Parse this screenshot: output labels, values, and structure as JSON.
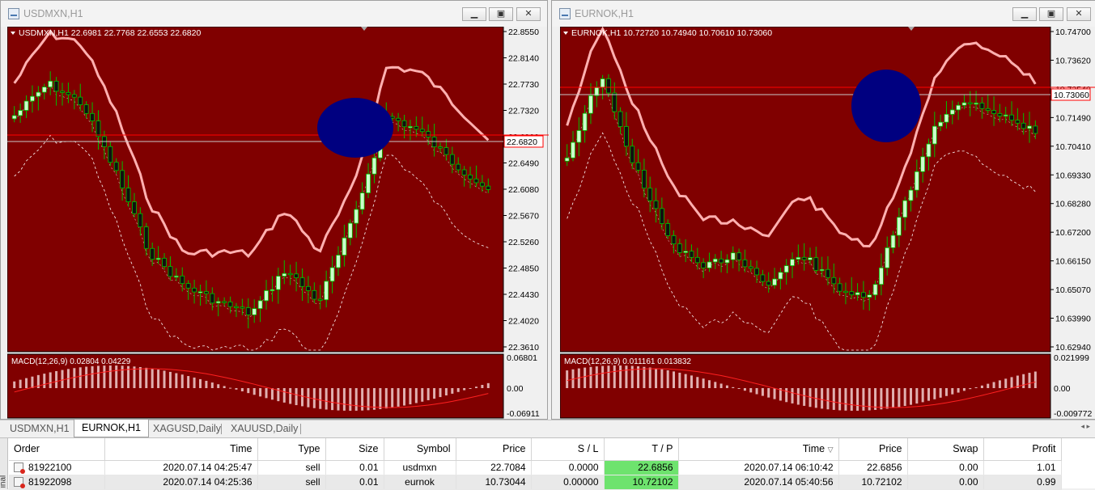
{
  "colors": {
    "chart_bg": "#800000",
    "bull": "#ccffcc",
    "bear": "#00c000",
    "band": "#ffb0b0",
    "macd_bar": "#e0b0b0",
    "signal": "#ff2020",
    "highlight_circle": "#000080",
    "tp_cell": "#6ee36e"
  },
  "left": {
    "title": "USDMXN,H1",
    "header": "USDMXN,H1  22.6981 22.7768 22.6553 22.6820",
    "price_ticks": [
      "22.8550",
      "22.8140",
      "22.7730",
      "22.7320",
      "22.6900",
      "22.6490",
      "22.6080",
      "22.5670",
      "22.5260",
      "22.4850",
      "22.4430",
      "22.4020",
      "22.3610"
    ],
    "current_price": "22.6820",
    "macd_label": "MACD(12,26,9) 0.02804 0.04229",
    "macd_ticks": [
      "0.06801",
      "0.00",
      "-0.06911"
    ]
  },
  "right": {
    "title": "EURNOK,H1",
    "header": "EURNOK,H1  10.72720 10.74940 10.70610 10.73060",
    "price_ticks": [
      "10.74700",
      "10.73620",
      "10.72540",
      "10.71490",
      "10.70410",
      "10.69330",
      "10.68280",
      "10.67200",
      "10.66150",
      "10.65070",
      "10.63990",
      "10.62940"
    ],
    "current_price": "10.73060",
    "macd_label": "MACD(12,26,9) 0.011161 0.013832",
    "macd_ticks": [
      "0.021999",
      "0.00",
      "-0.009772"
    ]
  },
  "window_buttons": {
    "minimize": "▁",
    "restore": "▣",
    "close": "✕"
  },
  "tabs": [
    "USDMXN,H1",
    "EURNOK,H1",
    "XAGUSD,Daily",
    "XAUUSD,Daily"
  ],
  "active_tab": 1,
  "terminal": {
    "side_label": "inal",
    "columns": [
      "Order",
      "Time",
      "Type",
      "Size",
      "Symbol",
      "Price",
      "S / L",
      "T / P",
      "Time",
      "Price",
      "Swap",
      "Profit"
    ],
    "sort_marker": "▽",
    "rows": [
      [
        "81922100",
        "2020.07.14 04:25:47",
        "sell",
        "0.01",
        "usdmxn",
        "22.7084",
        "0.0000",
        "22.6856",
        "2020.07.14 06:10:42",
        "22.6856",
        "0.00",
        "1.01"
      ],
      [
        "81922098",
        "2020.07.14 04:25:36",
        "sell",
        "0.01",
        "eurnok",
        "10.73044",
        "0.00000",
        "10.72102",
        "2020.07.14 05:40:56",
        "10.72102",
        "0.00",
        "0.99"
      ]
    ]
  },
  "icons": {
    "window": "chart-window-icon",
    "order": "order-closed-icon",
    "header_arrow": "triangle-down-icon"
  }
}
